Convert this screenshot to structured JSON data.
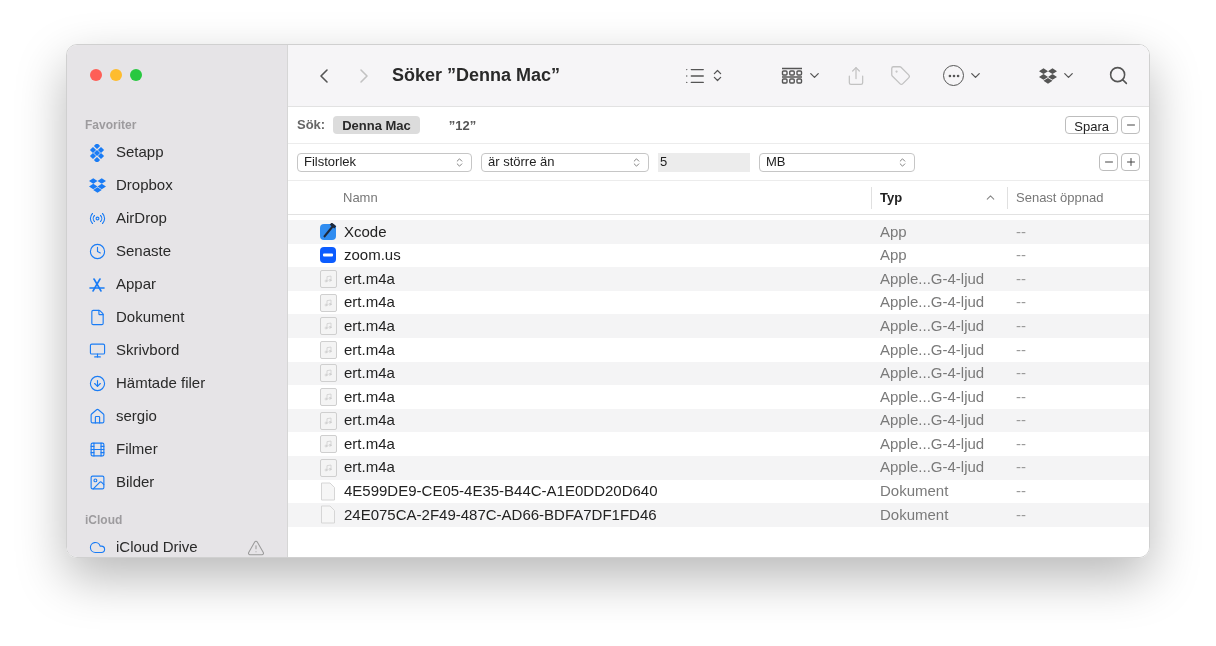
{
  "window": {
    "title": "Söker ”Denna Mac”"
  },
  "toolbar": [
    {
      "kind": "back",
      "disabled": false
    },
    {
      "kind": "forward",
      "disabled": true
    },
    {
      "kind": "title"
    },
    {
      "kind": "list-view",
      "disabled": false
    },
    {
      "kind": "group",
      "disabled": false
    },
    {
      "kind": "share",
      "disabled": true
    },
    {
      "kind": "tag",
      "disabled": true
    },
    {
      "kind": "more",
      "disabled": false
    },
    {
      "kind": "dropbox",
      "disabled": false
    },
    {
      "kind": "search",
      "disabled": false
    }
  ],
  "sidebar": {
    "sections": [
      {
        "title": "Favoriter",
        "items": [
          {
            "label": "Setapp",
            "kind": "setapp"
          },
          {
            "label": "Dropbox",
            "kind": "dropbox"
          },
          {
            "label": "AirDrop",
            "kind": "airdrop"
          },
          {
            "label": "Senaste",
            "kind": "recent"
          },
          {
            "label": "Appar",
            "kind": "apps"
          },
          {
            "label": "Dokument",
            "kind": "document"
          },
          {
            "label": "Skrivbord",
            "kind": "desktop"
          },
          {
            "label": "Hämtade filer",
            "kind": "downloads"
          },
          {
            "label": "sergio",
            "kind": "home"
          },
          {
            "label": "Filmer",
            "kind": "movies"
          },
          {
            "label": "Bilder",
            "kind": "pictures"
          }
        ]
      },
      {
        "title": "iCloud",
        "items": [
          {
            "label": "iCloud Drive",
            "kind": "icloud",
            "warning": true
          }
        ]
      }
    ]
  },
  "scope_bar": {
    "label": "Sök:",
    "scopes": [
      {
        "label": "Denna Mac",
        "selected": true
      },
      {
        "label": "”12”",
        "selected": false
      }
    ],
    "save_button": "Spara"
  },
  "criteria": [
    {
      "attribute": "Filstorlek",
      "operator": "är större än",
      "value": "5",
      "unit": "MB"
    }
  ],
  "table": {
    "columns": [
      {
        "label": "Namn",
        "sorted": false
      },
      {
        "label": "Typ",
        "sorted": true
      },
      {
        "label": "Senast öppnad",
        "sorted": false
      }
    ],
    "rows": [
      {
        "name": "Xcode",
        "kind": "xcode",
        "type": "App",
        "opened": "--"
      },
      {
        "name": "zoom.us",
        "kind": "zoom",
        "type": "App",
        "opened": "--"
      },
      {
        "name": "ert.m4a",
        "kind": "audio",
        "type": "Apple...G-4-ljud",
        "opened": "--"
      },
      {
        "name": "ert.m4a",
        "kind": "audio",
        "type": "Apple...G-4-ljud",
        "opened": "--"
      },
      {
        "name": "ert.m4a",
        "kind": "audio",
        "type": "Apple...G-4-ljud",
        "opened": "--"
      },
      {
        "name": "ert.m4a",
        "kind": "audio",
        "type": "Apple...G-4-ljud",
        "opened": "--"
      },
      {
        "name": "ert.m4a",
        "kind": "audio",
        "type": "Apple...G-4-ljud",
        "opened": "--"
      },
      {
        "name": "ert.m4a",
        "kind": "audio",
        "type": "Apple...G-4-ljud",
        "opened": "--"
      },
      {
        "name": "ert.m4a",
        "kind": "audio",
        "type": "Apple...G-4-ljud",
        "opened": "--"
      },
      {
        "name": "ert.m4a",
        "kind": "audio",
        "type": "Apple...G-4-ljud",
        "opened": "--"
      },
      {
        "name": "ert.m4a",
        "kind": "audio",
        "type": "Apple...G-4-ljud",
        "opened": "--"
      },
      {
        "name": "4E599DE9-CE05-4E35-B44C-A1E0DD20D640",
        "kind": "document",
        "type": "Dokument",
        "opened": "--"
      },
      {
        "name": "24E075CA-2F49-487C-AD66-BDFA7DF1FD46",
        "kind": "document",
        "type": "Dokument",
        "opened": "--"
      }
    ]
  }
}
